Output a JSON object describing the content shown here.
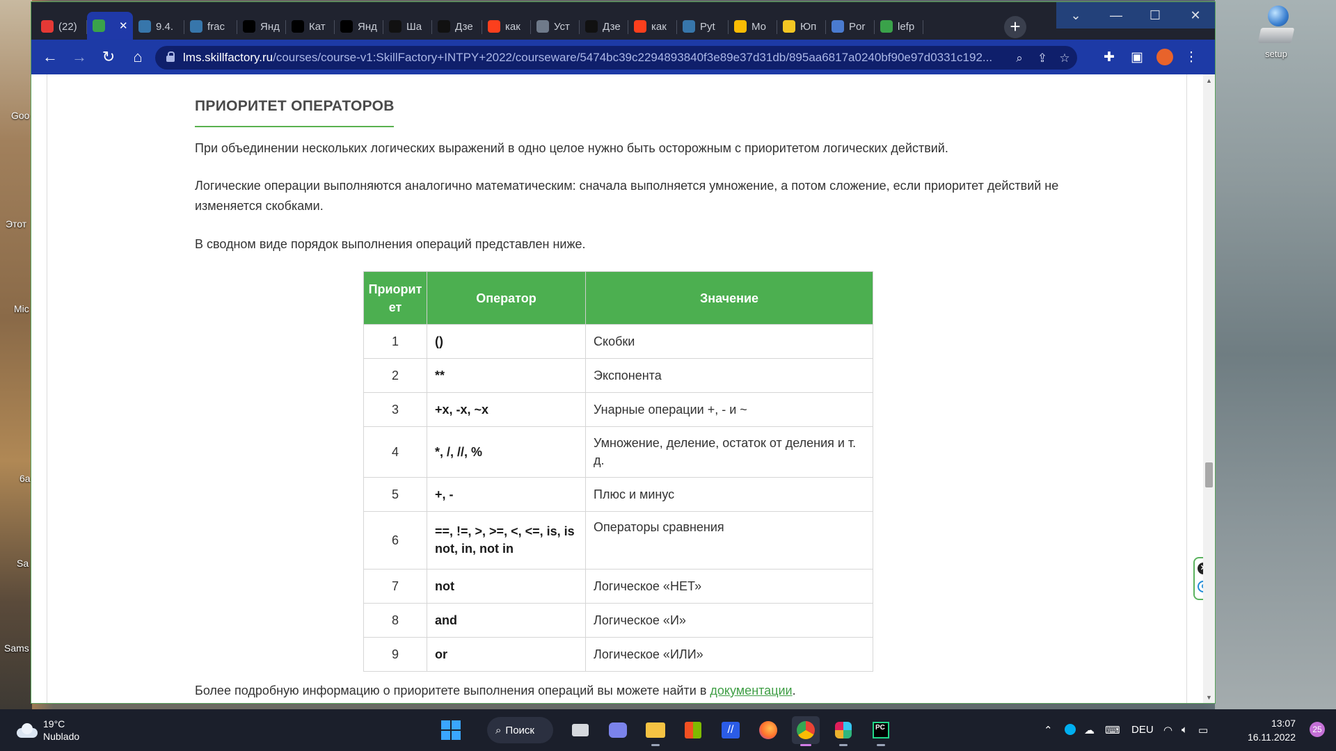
{
  "desktop": {
    "left_labels": [
      "Goo",
      "Этот",
      "Mic",
      "6a",
      "Sa",
      "Sams"
    ],
    "icon_label": "setup"
  },
  "browser": {
    "tabs": [
      {
        "label": "(22)",
        "icon": "youtube-icon",
        "color": "#e53935"
      },
      {
        "label": "",
        "icon": "skillfactory-icon",
        "color": "#3aa24a",
        "active": true
      },
      {
        "label": "9.4.",
        "icon": "python-icon",
        "color": "#3776ab"
      },
      {
        "label": "frac",
        "icon": "python-icon",
        "color": "#3776ab"
      },
      {
        "label": "Янд",
        "icon": "yandex-practicum-icon",
        "color": "#000000"
      },
      {
        "label": "Кат",
        "icon": "yandex-practicum-icon",
        "color": "#000000"
      },
      {
        "label": "Янд",
        "icon": "yandex-practicum-icon",
        "color": "#000000"
      },
      {
        "label": "Ша",
        "icon": "codewars-icon",
        "color": "#111111"
      },
      {
        "label": "Дзе",
        "icon": "dzen-icon",
        "color": "#111111"
      },
      {
        "label": "как",
        "icon": "yandex-icon",
        "color": "#fc3f1d"
      },
      {
        "label": "Уст",
        "icon": "doc-icon",
        "color": "#6f7a8a"
      },
      {
        "label": "Дзе",
        "icon": "dzen-icon",
        "color": "#111111"
      },
      {
        "label": "как",
        "icon": "yandex-icon",
        "color": "#fc3f1d"
      },
      {
        "label": "Pyt",
        "icon": "python-icon",
        "color": "#3776ab"
      },
      {
        "label": "Мо",
        "icon": "drive-icon",
        "color": "#fbbc04"
      },
      {
        "label": "Юп",
        "icon": "bulb-icon",
        "color": "#f3c623"
      },
      {
        "label": "Por",
        "icon": "chart-icon",
        "color": "#4a7bd0"
      },
      {
        "label": "lefp",
        "icon": "leaf-icon",
        "color": "#3aa24a"
      }
    ],
    "active_tab_close": "✕",
    "new_tab": "+",
    "url_host": "lms.skillfactory.ru",
    "url_path": "/courses/course-v1:SkillFactory+INTPY+2022/courseware/5474bc39c2294893840f3e89e37d31db/895aa6817a0240bf90e97d0331c192..."
  },
  "page": {
    "heading": "ПРИОРИТЕТ ОПЕРАТОРОВ",
    "para1": "При объединении нескольких логических выражений в одно целое нужно быть осторожным с приоритетом логических действий.",
    "para2": "Логические операции выполняются аналогично математическим: сначала выполняется умножение, а потом сложение, если приоритет действий не изменяется скобками.",
    "para3": "В сводном виде порядок выполнения операций представлен ниже.",
    "table": {
      "headers": [
        "Приорит ет",
        "Оператор",
        "Значение"
      ],
      "rows": [
        {
          "priority": "1",
          "operator": "()",
          "meaning": "Скобки"
        },
        {
          "priority": "2",
          "operator": "**",
          "meaning": "Экспонента"
        },
        {
          "priority": "3",
          "operator": "+x, -x, ~x",
          "meaning": "Унарные операции +, - и ~"
        },
        {
          "priority": "4",
          "operator": "*, /, //, %",
          "meaning": "Умножение, деление, остаток от деления и т. д."
        },
        {
          "priority": "5",
          "operator": "+, -",
          "meaning": "Плюс и минус"
        },
        {
          "priority": "6",
          "operator": "==, !=, >, >=, <, <=, is, is not, in, not in",
          "meaning": "Операторы сравнения"
        },
        {
          "priority": "7",
          "operator": "not",
          "meaning": "Логическое «НЕТ»"
        },
        {
          "priority": "8",
          "operator": "and",
          "meaning": "Логическое «И»"
        },
        {
          "priority": "9",
          "operator": "or",
          "meaning": "Логическое «ИЛИ»"
        }
      ]
    },
    "footer_text": "Более подробную информацию о приоритете выполнения операций вы можете найти в ",
    "footer_link": "документации",
    "footer_end": "."
  },
  "taskbar": {
    "temperature": "19°C",
    "weather": "Nublado",
    "search_label": "Поиск",
    "language": "DEU",
    "time": "13:07",
    "date": "16.11.2022",
    "notifications": "25"
  }
}
